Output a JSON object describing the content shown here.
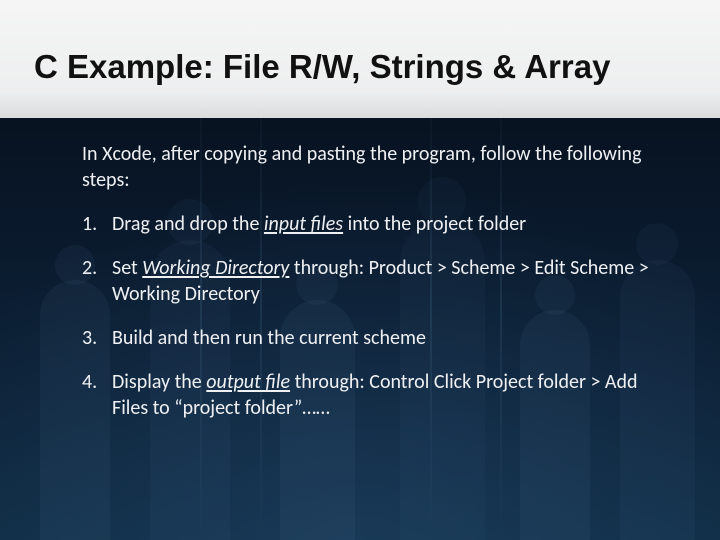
{
  "title": "C Example: File R/W, Strings & Array",
  "intro": "In Xcode, after copying and pasting the program, follow the following steps:",
  "steps": {
    "s1": {
      "pre": "Drag and drop the ",
      "em": "input files",
      "post": " into the project folder"
    },
    "s2": {
      "pre": "Set ",
      "em": "Working Directory",
      "post": " through: Product > Scheme > Edit Scheme > Working Directory"
    },
    "s3": {
      "text": "Build and then run the current scheme"
    },
    "s4": {
      "pre": "Display the ",
      "em": "output file",
      "post": " through: Control Click Project folder > Add Files to “project folder”……"
    }
  }
}
